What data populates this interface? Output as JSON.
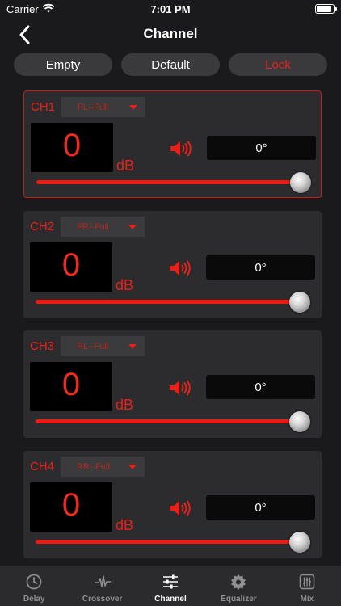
{
  "status": {
    "carrier": "Carrier",
    "time": "7:01 PM"
  },
  "nav": {
    "title": "Channel"
  },
  "top_buttons": {
    "empty": "Empty",
    "default": "Default",
    "lock": "Lock"
  },
  "channels": [
    {
      "label": "CH1",
      "output": "FL--Full",
      "gain": "0",
      "unit": "dB",
      "phase": "0°",
      "level": 1.0,
      "selected": true
    },
    {
      "label": "CH2",
      "output": "FR--Full",
      "gain": "0",
      "unit": "dB",
      "phase": "0°",
      "level": 1.0,
      "selected": false
    },
    {
      "label": "CH3",
      "output": "RL--Full",
      "gain": "0",
      "unit": "dB",
      "phase": "0°",
      "level": 1.0,
      "selected": false
    },
    {
      "label": "CH4",
      "output": "RR--Full",
      "gain": "0",
      "unit": "dB",
      "phase": "0°",
      "level": 1.0,
      "selected": false
    }
  ],
  "tabs": [
    {
      "label": "Delay",
      "icon": "clock-icon"
    },
    {
      "label": "Crossover",
      "icon": "waveform-icon"
    },
    {
      "label": "Channel",
      "icon": "sliders-icon",
      "active": true
    },
    {
      "label": "Equalizer",
      "icon": "gear-icon"
    },
    {
      "label": "Mix",
      "icon": "mixer-icon"
    }
  ],
  "colors": {
    "accent": "#e8201a",
    "card": "#2c2c2e",
    "background": "#1a1a1c"
  }
}
